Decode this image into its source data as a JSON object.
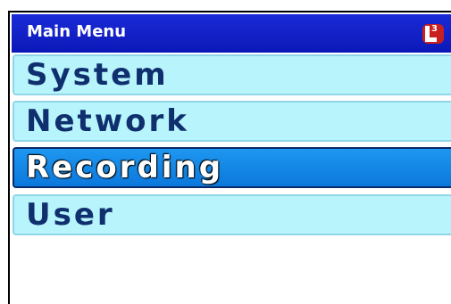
{
  "header": {
    "title": "Main Menu",
    "logo": {
      "icon": "l3-logo-icon",
      "letter": "L",
      "superscript": "3",
      "color": "#c8201f"
    }
  },
  "menu": {
    "items": [
      {
        "label": "System",
        "selected": false
      },
      {
        "label": "Network",
        "selected": false
      },
      {
        "label": "Recording",
        "selected": true
      },
      {
        "label": "User",
        "selected": false
      }
    ]
  },
  "colors": {
    "title_bar": "#1a2bd6",
    "menu_item_bg": "#b7f4fb",
    "menu_item_text": "#0f2f6e",
    "selected_bg": "#1e97f0",
    "selected_text": "#ffffff"
  }
}
